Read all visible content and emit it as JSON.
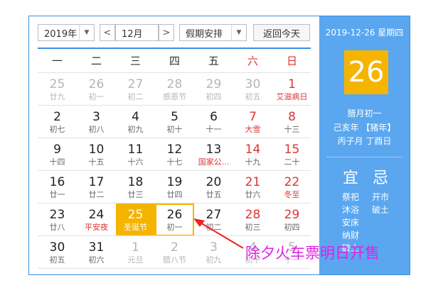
{
  "header": {
    "year": "2019年",
    "month": "12月",
    "holiday": "假期安排",
    "today_btn": "返回今天",
    "prev": "<",
    "next": ">"
  },
  "weekdays": [
    "一",
    "二",
    "三",
    "四",
    "五",
    "六",
    "日"
  ],
  "weeks": [
    [
      {
        "d": "25",
        "s": "廿九",
        "g": true
      },
      {
        "d": "26",
        "s": "初一",
        "g": true
      },
      {
        "d": "27",
        "s": "初二",
        "g": true
      },
      {
        "d": "28",
        "s": "感恩节",
        "g": true
      },
      {
        "d": "29",
        "s": "初四",
        "g": true
      },
      {
        "d": "30",
        "s": "初五",
        "g": true
      },
      {
        "d": "1",
        "s": "艾滋病日",
        "sr": true
      }
    ],
    [
      {
        "d": "2",
        "s": "初七"
      },
      {
        "d": "3",
        "s": "初八"
      },
      {
        "d": "4",
        "s": "初九"
      },
      {
        "d": "5",
        "s": "初十"
      },
      {
        "d": "6",
        "s": "十一"
      },
      {
        "d": "7",
        "s": "大雪",
        "sr": true
      },
      {
        "d": "8",
        "s": "十三"
      }
    ],
    [
      {
        "d": "9",
        "s": "十四"
      },
      {
        "d": "10",
        "s": "十五"
      },
      {
        "d": "11",
        "s": "十六"
      },
      {
        "d": "12",
        "s": "十七"
      },
      {
        "d": "13",
        "s": "国家公...",
        "sr": true
      },
      {
        "d": "14",
        "s": "十九"
      },
      {
        "d": "15",
        "s": "二十"
      }
    ],
    [
      {
        "d": "16",
        "s": "廿一"
      },
      {
        "d": "17",
        "s": "廿二"
      },
      {
        "d": "18",
        "s": "廿三"
      },
      {
        "d": "19",
        "s": "廿四"
      },
      {
        "d": "20",
        "s": "廿五"
      },
      {
        "d": "21",
        "s": "廿六"
      },
      {
        "d": "22",
        "s": "冬至",
        "sr": true
      }
    ],
    [
      {
        "d": "23",
        "s": "廿八"
      },
      {
        "d": "24",
        "s": "平安夜",
        "sr": true
      },
      {
        "d": "25",
        "s": "圣诞节",
        "hl": true
      },
      {
        "d": "26",
        "s": "初一",
        "today": true
      },
      {
        "d": "27",
        "s": "初二"
      },
      {
        "d": "28",
        "s": "初三"
      },
      {
        "d": "29",
        "s": "初四"
      }
    ],
    [
      {
        "d": "30",
        "s": "初五"
      },
      {
        "d": "31",
        "s": "初六"
      },
      {
        "d": "1",
        "s": "元旦",
        "g": true
      },
      {
        "d": "2",
        "s": "腊八节",
        "g": true
      },
      {
        "d": "3",
        "s": "初九",
        "g": true
      },
      {
        "d": "4",
        "s": "初十",
        "g": true
      },
      {
        "d": "5",
        "s": "十一",
        "g": true
      }
    ]
  ],
  "side": {
    "date": "2019-12-26 星期四",
    "big_day": "26",
    "lunar1": "腊月初一",
    "lunar2": "己亥年 【猪年】",
    "lunar3": "丙子月 丁酉日",
    "yi_title": "宜",
    "ji_title": "忌",
    "yi_items": [
      "祭祀",
      "沐浴",
      "安床",
      "纳财",
      "破土"
    ],
    "ji_items": [
      "开市",
      "破土"
    ]
  },
  "annotation": "除夕火车票明日开售",
  "colors": {
    "accent": "#3a8fe0",
    "highlight": "#f5b400",
    "weekend": "#dd3333",
    "annotation": "#e020e6",
    "side_bg": "#5aa7f0"
  }
}
